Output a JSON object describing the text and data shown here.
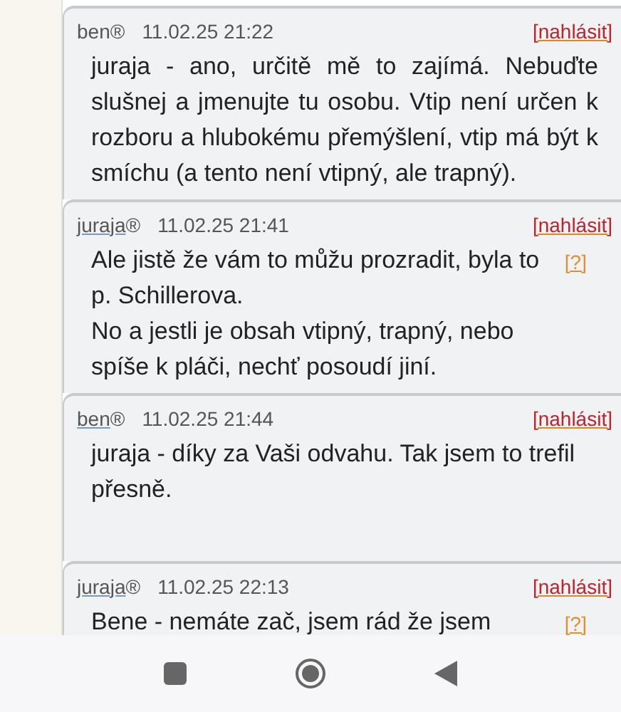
{
  "comments": [
    {
      "author": "ben",
      "author_linked": false,
      "mark": "®",
      "date": "11.02.25 21:22",
      "report": "[nahlásit]",
      "text": "juraja - ano, určitě mě to zajímá. Nebuďte slušnej a jmenujte tu osobu. Vtip není určen k rozboru a hlubokému přemýšlení, vtip má být k smíchu (a tento není vtipný, ale trapný).",
      "justified": true
    },
    {
      "author": "juraja",
      "author_linked": true,
      "mark": "®",
      "date": "11.02.25 21:41",
      "report": "[nahlásit]",
      "text": "Ale jistě že vám to můžu prozradit, byla to p. Schillerova.\nNo a jestli je obsah vtipný, trapný, nebo spíše k pláči, nechť posoudí jiní.",
      "help": "[?]",
      "justified": false
    },
    {
      "author": "ben",
      "author_linked": true,
      "mark": "®",
      "date": "11.02.25 21:44",
      "report": "[nahlásit]",
      "text": "juraja - díky za Vaši odvahu. Tak jsem to trefil přesně.",
      "justified": false
    },
    {
      "author": "juraja",
      "author_linked": true,
      "mark": "®",
      "date": "11.02.25 22:13",
      "report": "[nahlásit]",
      "text": "Bene - nemáte zač, jsem rád že jsem",
      "help": "[?]",
      "justified": true
    }
  ]
}
